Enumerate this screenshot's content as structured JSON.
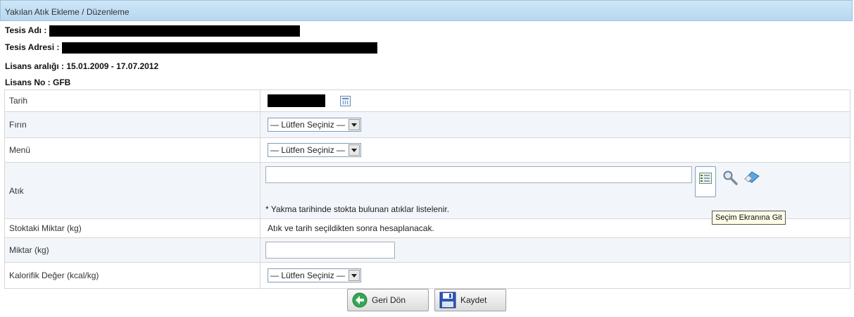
{
  "header": {
    "title": "Yakılan Atık Ekleme / Düzenleme"
  },
  "info": {
    "tesis_adi_label": "Tesis Adı :",
    "tesis_adresi_label": "Tesis Adresi :",
    "lisans_araligi": "Lisans aralığı : 15.01.2009 - 17.07.2012",
    "lisans_no": "Lisans No : GFB"
  },
  "form": {
    "tarih": {
      "label": "Tarih"
    },
    "firin": {
      "label": "Fırın",
      "selected": "— Lütfen Seçiniz —"
    },
    "menu": {
      "label": "Menü",
      "selected": "— Lütfen Seçiniz —"
    },
    "atik": {
      "label": "Atık",
      "note": "* Yakma tarihinde stokta bulunan atıklar listelenir."
    },
    "stok": {
      "label": "Stoktaki Miktar (kg)",
      "value": "Atık ve tarih seçildikten sonra hesaplanacak."
    },
    "miktar": {
      "label": "Miktar (kg)"
    },
    "kalorifik": {
      "label": "Kalorifik Değer (kcal/kg)",
      "selected": "— Lütfen Seçiniz —"
    }
  },
  "buttons": {
    "back": "Geri Dön",
    "save": "Kaydet"
  },
  "tooltip": "Seçim Ekranına Git",
  "icons": {
    "calendar": "calendar-icon",
    "list": "list-select-icon",
    "search": "magnifier-icon",
    "clear": "eraser-icon",
    "back": "back-arrow-icon",
    "save": "floppy-disk-icon"
  },
  "colors": {
    "header_bg": "#b6d7f0",
    "alt_row": "#f2f6fb",
    "border": "#d7d7d7"
  }
}
